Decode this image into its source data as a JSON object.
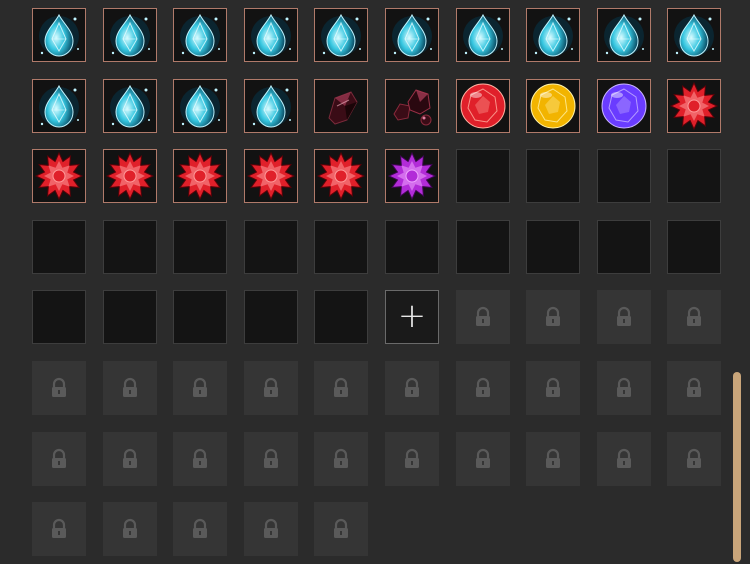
{
  "inventory": {
    "columns": 10,
    "slots": [
      {
        "type": "item",
        "icon": "aqua-drop-gem-icon"
      },
      {
        "type": "item",
        "icon": "aqua-drop-gem-icon"
      },
      {
        "type": "item",
        "icon": "aqua-drop-gem-icon"
      },
      {
        "type": "item",
        "icon": "aqua-drop-gem-icon"
      },
      {
        "type": "item",
        "icon": "aqua-drop-gem-icon"
      },
      {
        "type": "item",
        "icon": "aqua-drop-gem-icon"
      },
      {
        "type": "item",
        "icon": "aqua-drop-gem-icon"
      },
      {
        "type": "item",
        "icon": "aqua-drop-gem-icon"
      },
      {
        "type": "item",
        "icon": "aqua-drop-gem-icon"
      },
      {
        "type": "item",
        "icon": "aqua-drop-gem-icon"
      },
      {
        "type": "item",
        "icon": "aqua-drop-gem-icon"
      },
      {
        "type": "item",
        "icon": "aqua-drop-gem-icon"
      },
      {
        "type": "item",
        "icon": "aqua-drop-gem-icon"
      },
      {
        "type": "item",
        "icon": "aqua-drop-gem-icon"
      },
      {
        "type": "item",
        "icon": "dark-garnet-shard-icon"
      },
      {
        "type": "item",
        "icon": "dark-garnet-cluster-icon"
      },
      {
        "type": "item",
        "icon": "red-round-gem-icon"
      },
      {
        "type": "item",
        "icon": "yellow-round-gem-icon"
      },
      {
        "type": "item",
        "icon": "purple-round-gem-icon"
      },
      {
        "type": "item",
        "icon": "red-star-gem-icon"
      },
      {
        "type": "item",
        "icon": "red-star-gem-icon"
      },
      {
        "type": "item",
        "icon": "red-star-gem-icon"
      },
      {
        "type": "item",
        "icon": "red-star-gem-icon"
      },
      {
        "type": "item",
        "icon": "red-star-gem-icon"
      },
      {
        "type": "item",
        "icon": "red-star-gem-icon"
      },
      {
        "type": "item",
        "icon": "purple-star-gem-icon"
      },
      {
        "type": "empty"
      },
      {
        "type": "empty"
      },
      {
        "type": "empty"
      },
      {
        "type": "empty"
      },
      {
        "type": "empty"
      },
      {
        "type": "empty"
      },
      {
        "type": "empty"
      },
      {
        "type": "empty"
      },
      {
        "type": "empty"
      },
      {
        "type": "empty"
      },
      {
        "type": "empty"
      },
      {
        "type": "empty"
      },
      {
        "type": "empty"
      },
      {
        "type": "empty"
      },
      {
        "type": "empty"
      },
      {
        "type": "empty"
      },
      {
        "type": "empty"
      },
      {
        "type": "empty"
      },
      {
        "type": "empty"
      },
      {
        "type": "add",
        "label": "+"
      },
      {
        "type": "locked"
      },
      {
        "type": "locked"
      },
      {
        "type": "locked"
      },
      {
        "type": "locked"
      },
      {
        "type": "locked"
      },
      {
        "type": "locked"
      },
      {
        "type": "locked"
      },
      {
        "type": "locked"
      },
      {
        "type": "locked"
      },
      {
        "type": "locked"
      },
      {
        "type": "locked"
      },
      {
        "type": "locked"
      },
      {
        "type": "locked"
      },
      {
        "type": "locked"
      },
      {
        "type": "locked"
      },
      {
        "type": "locked"
      },
      {
        "type": "locked"
      },
      {
        "type": "locked"
      },
      {
        "type": "locked"
      },
      {
        "type": "locked"
      },
      {
        "type": "locked"
      },
      {
        "type": "locked"
      },
      {
        "type": "locked"
      },
      {
        "type": "locked"
      },
      {
        "type": "locked"
      },
      {
        "type": "locked"
      },
      {
        "type": "locked"
      },
      {
        "type": "locked"
      },
      {
        "type": "locked"
      }
    ]
  },
  "colors": {
    "aqua": "#35c6e0",
    "red": "#e0202a",
    "yellow": "#f2b400",
    "purple": "#6a3cff",
    "magenta": "#b22cd8",
    "garnet": "#3a0c16",
    "lock": "#5a5a5a",
    "scroll_thumb": "#c9a57a"
  }
}
